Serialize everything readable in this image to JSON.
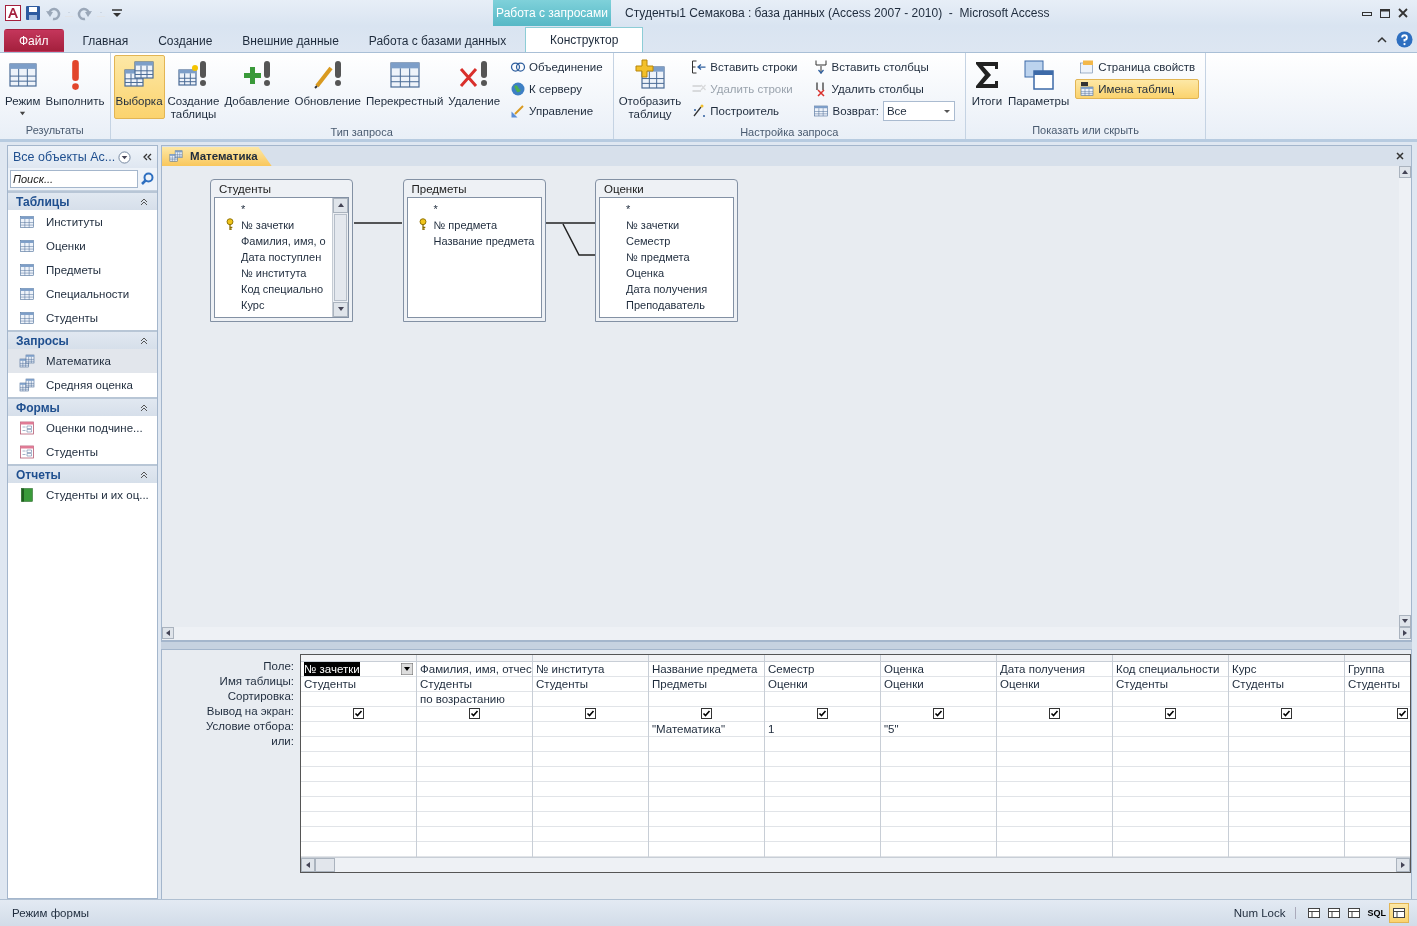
{
  "window": {
    "title": "Студенты1 Семакова : база данных (Access 2007 - 2010)  -  Microsoft Access",
    "context_label": "Работа с запросами"
  },
  "ribbon_tabs": [
    {
      "label": "Файл",
      "kind": "file",
      "selected": false
    },
    {
      "label": "Главная",
      "kind": "tab",
      "selected": false
    },
    {
      "label": "Создание",
      "kind": "tab",
      "selected": false
    },
    {
      "label": "Внешние данные",
      "kind": "tab",
      "selected": false
    },
    {
      "label": "Работа с базами данных",
      "kind": "tab",
      "selected": false
    },
    {
      "label": "Конструктор",
      "kind": "context",
      "selected": true
    }
  ],
  "ribbon_groups": [
    {
      "label": "Результаты",
      "items": [
        {
          "kind": "large",
          "label": "Режим",
          "dropdown": true,
          "selected": false
        },
        {
          "kind": "large",
          "label": "Выполнить",
          "selected": false
        }
      ]
    },
    {
      "label": "Тип запроса",
      "items": [
        {
          "kind": "large",
          "label": "Выборка",
          "selected": true
        },
        {
          "kind": "large",
          "label": "Создание\nтаблицы",
          "selected": false
        },
        {
          "kind": "large",
          "label": "Добавление",
          "selected": false
        },
        {
          "kind": "large",
          "label": "Обновление",
          "selected": false
        },
        {
          "kind": "large",
          "label": "Перекрестный",
          "selected": false
        },
        {
          "kind": "large",
          "label": "Удаление",
          "selected": false
        },
        {
          "kind": "stack",
          "items": [
            {
              "kind": "small",
              "label": "Объединение",
              "disabled": false,
              "selected": false
            },
            {
              "kind": "small",
              "label": "К серверу",
              "disabled": false,
              "selected": false
            },
            {
              "kind": "small",
              "label": "Управление",
              "disabled": false,
              "selected": false
            }
          ]
        }
      ]
    },
    {
      "label": "Настройка запроса",
      "items": [
        {
          "kind": "large",
          "label": "Отобразить\nтаблицу",
          "selected": false
        },
        {
          "kind": "stack",
          "items": [
            {
              "kind": "small",
              "label": "Вставить строки",
              "disabled": false,
              "selected": false
            },
            {
              "kind": "small",
              "label": "Удалить строки",
              "disabled": true,
              "selected": false
            },
            {
              "kind": "small",
              "label": "Построитель",
              "disabled": false,
              "selected": false
            }
          ]
        },
        {
          "kind": "stack",
          "items": [
            {
              "kind": "small",
              "label": "Вставить столбцы",
              "disabled": false,
              "selected": false
            },
            {
              "kind": "small",
              "label": "Удалить столбцы",
              "disabled": false,
              "selected": false
            },
            {
              "kind": "combo",
              "label": "Возврат:",
              "value": "Все"
            }
          ]
        }
      ]
    },
    {
      "label": "Показать или скрыть",
      "items": [
        {
          "kind": "large",
          "label": "Итоги",
          "selected": false
        },
        {
          "kind": "large",
          "label": "Параметры",
          "selected": false
        },
        {
          "kind": "stack",
          "items": [
            {
              "kind": "small",
              "label": "Страница свойств",
              "disabled": false,
              "selected": false
            },
            {
              "kind": "small",
              "label": "Имена таблиц",
              "disabled": false,
              "selected": true
            }
          ]
        }
      ]
    }
  ],
  "nav": {
    "title": "Все объекты Ac...",
    "search_placeholder": "Поиск...",
    "groups": [
      {
        "label": "Таблицы",
        "kind": "tables",
        "items": [
          {
            "label": "Институты",
            "selected": false
          },
          {
            "label": "Оценки",
            "selected": false
          },
          {
            "label": "Предметы",
            "selected": false
          },
          {
            "label": "Специальности",
            "selected": false
          },
          {
            "label": "Студенты",
            "selected": false
          }
        ]
      },
      {
        "label": "Запросы",
        "kind": "queries",
        "items": [
          {
            "label": "Математика",
            "selected": true
          },
          {
            "label": "Средняя оценка",
            "selected": false
          }
        ]
      },
      {
        "label": "Формы",
        "kind": "forms",
        "items": [
          {
            "label": "Оценки подчине...",
            "selected": false
          },
          {
            "label": "Студенты",
            "selected": false
          }
        ]
      },
      {
        "label": "Отчеты",
        "kind": "reports",
        "items": [
          {
            "label": "Студенты и их оц...",
            "selected": false
          }
        ]
      }
    ]
  },
  "document_tab": {
    "label": "Математика"
  },
  "query_tables": [
    {
      "title": "Студенты",
      "scrollable": true,
      "fields": [
        {
          "name": "*",
          "primary_key": false
        },
        {
          "name": "№ зачетки",
          "primary_key": true
        },
        {
          "name": "Фамилия, имя, о",
          "primary_key": false
        },
        {
          "name": "Дата поступлен",
          "primary_key": false
        },
        {
          "name": "№ института",
          "primary_key": false
        },
        {
          "name": "Код специально",
          "primary_key": false
        },
        {
          "name": "Курс",
          "primary_key": false
        }
      ]
    },
    {
      "title": "Предметы",
      "scrollable": false,
      "fields": [
        {
          "name": "*",
          "primary_key": false
        },
        {
          "name": "№ предмета",
          "primary_key": true
        },
        {
          "name": "Название предмета",
          "primary_key": false
        }
      ]
    },
    {
      "title": "Оценки",
      "scrollable": false,
      "fields": [
        {
          "name": "*",
          "primary_key": false
        },
        {
          "name": "№ зачетки",
          "primary_key": false
        },
        {
          "name": "Семестр",
          "primary_key": false
        },
        {
          "name": "№ предмета",
          "primary_key": false
        },
        {
          "name": "Оценка",
          "primary_key": false
        },
        {
          "name": "Дата получения",
          "primary_key": false
        },
        {
          "name": "Преподаватель",
          "primary_key": false
        }
      ]
    }
  ],
  "grid": {
    "row_labels": [
      "Поле:",
      "Имя таблицы:",
      "Сортировка:",
      "Вывод на экран:",
      "Условие отбора:",
      "или:"
    ],
    "columns": [
      {
        "field": "№ зачетки",
        "table": "Студенты",
        "show": true,
        "selected": true
      },
      {
        "field": "Фамилия, имя, отчес",
        "table": "Студенты",
        "sort": "по возрастанию",
        "show": true,
        "selected": false
      },
      {
        "field": "№ института",
        "table": "Студенты",
        "show": true,
        "selected": false
      },
      {
        "field": "Название предмета",
        "table": "Предметы",
        "show": true,
        "criteria": "\"Математика\"",
        "selected": false
      },
      {
        "field": "Семестр",
        "table": "Оценки",
        "show": true,
        "criteria": "1",
        "selected": false
      },
      {
        "field": "Оценка",
        "table": "Оценки",
        "show": true,
        "criteria": "\"5\"",
        "selected": false
      },
      {
        "field": "Дата получения",
        "table": "Оценки",
        "show": true,
        "selected": false
      },
      {
        "field": "Код специальности",
        "table": "Студенты",
        "show": true,
        "selected": false
      },
      {
        "field": "Курс",
        "table": "Студенты",
        "show": true,
        "selected": false
      },
      {
        "field": "Группа",
        "table": "Студенты",
        "show": true,
        "selected": false
      }
    ]
  },
  "status_bar": {
    "text": "Режим формы",
    "indicator": "Num Lock",
    "views": [
      {
        "kind": "icon",
        "selected": false
      },
      {
        "kind": "icon",
        "selected": false
      },
      {
        "kind": "icon",
        "selected": false
      },
      {
        "kind": "text",
        "label": "SQL",
        "selected": false
      },
      {
        "kind": "icon",
        "selected": true
      }
    ]
  }
}
